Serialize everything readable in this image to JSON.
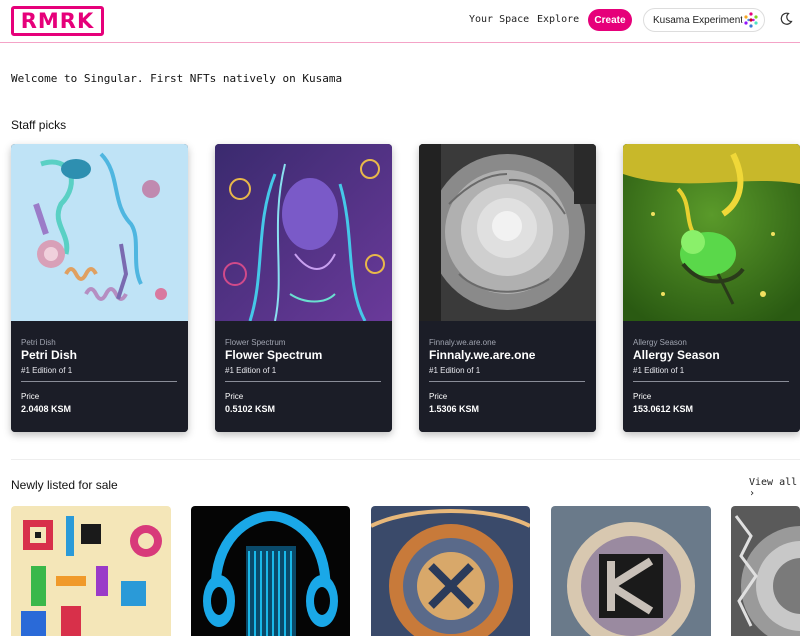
{
  "header": {
    "logo_text": "RMRK",
    "nav": {
      "your_space": "Your Space",
      "explore": "Explore"
    },
    "create_label": "Create",
    "network_label": "Kusama Experiment",
    "theme_icon": "moon-icon",
    "brand_color": "#e6007a"
  },
  "welcome_text": "Welcome to Singular. First NFTs natively on Kusama",
  "staff_picks": {
    "title": "Staff picks",
    "cards": [
      {
        "collection": "Petri Dish",
        "name": "Petri Dish",
        "edition": "#1 Edition of 1",
        "price_label": "Price",
        "price": "2.0408 KSM"
      },
      {
        "collection": "Flower Spectrum",
        "name": "Flower Spectrum",
        "edition": "#1 Edition of 1",
        "price_label": "Price",
        "price": "0.5102 KSM"
      },
      {
        "collection": "Finnaly.we.are.one",
        "name": "Finnaly.we.are.one",
        "edition": "#1 Edition of 1",
        "price_label": "Price",
        "price": "1.5306 KSM"
      },
      {
        "collection": "Allergy Season",
        "name": "Allergy Season",
        "edition": "#1 Edition of 1",
        "price_label": "Price",
        "price": "153.0612 KSM"
      }
    ]
  },
  "newly_listed": {
    "title": "Newly listed for sale",
    "view_all": "View all"
  }
}
